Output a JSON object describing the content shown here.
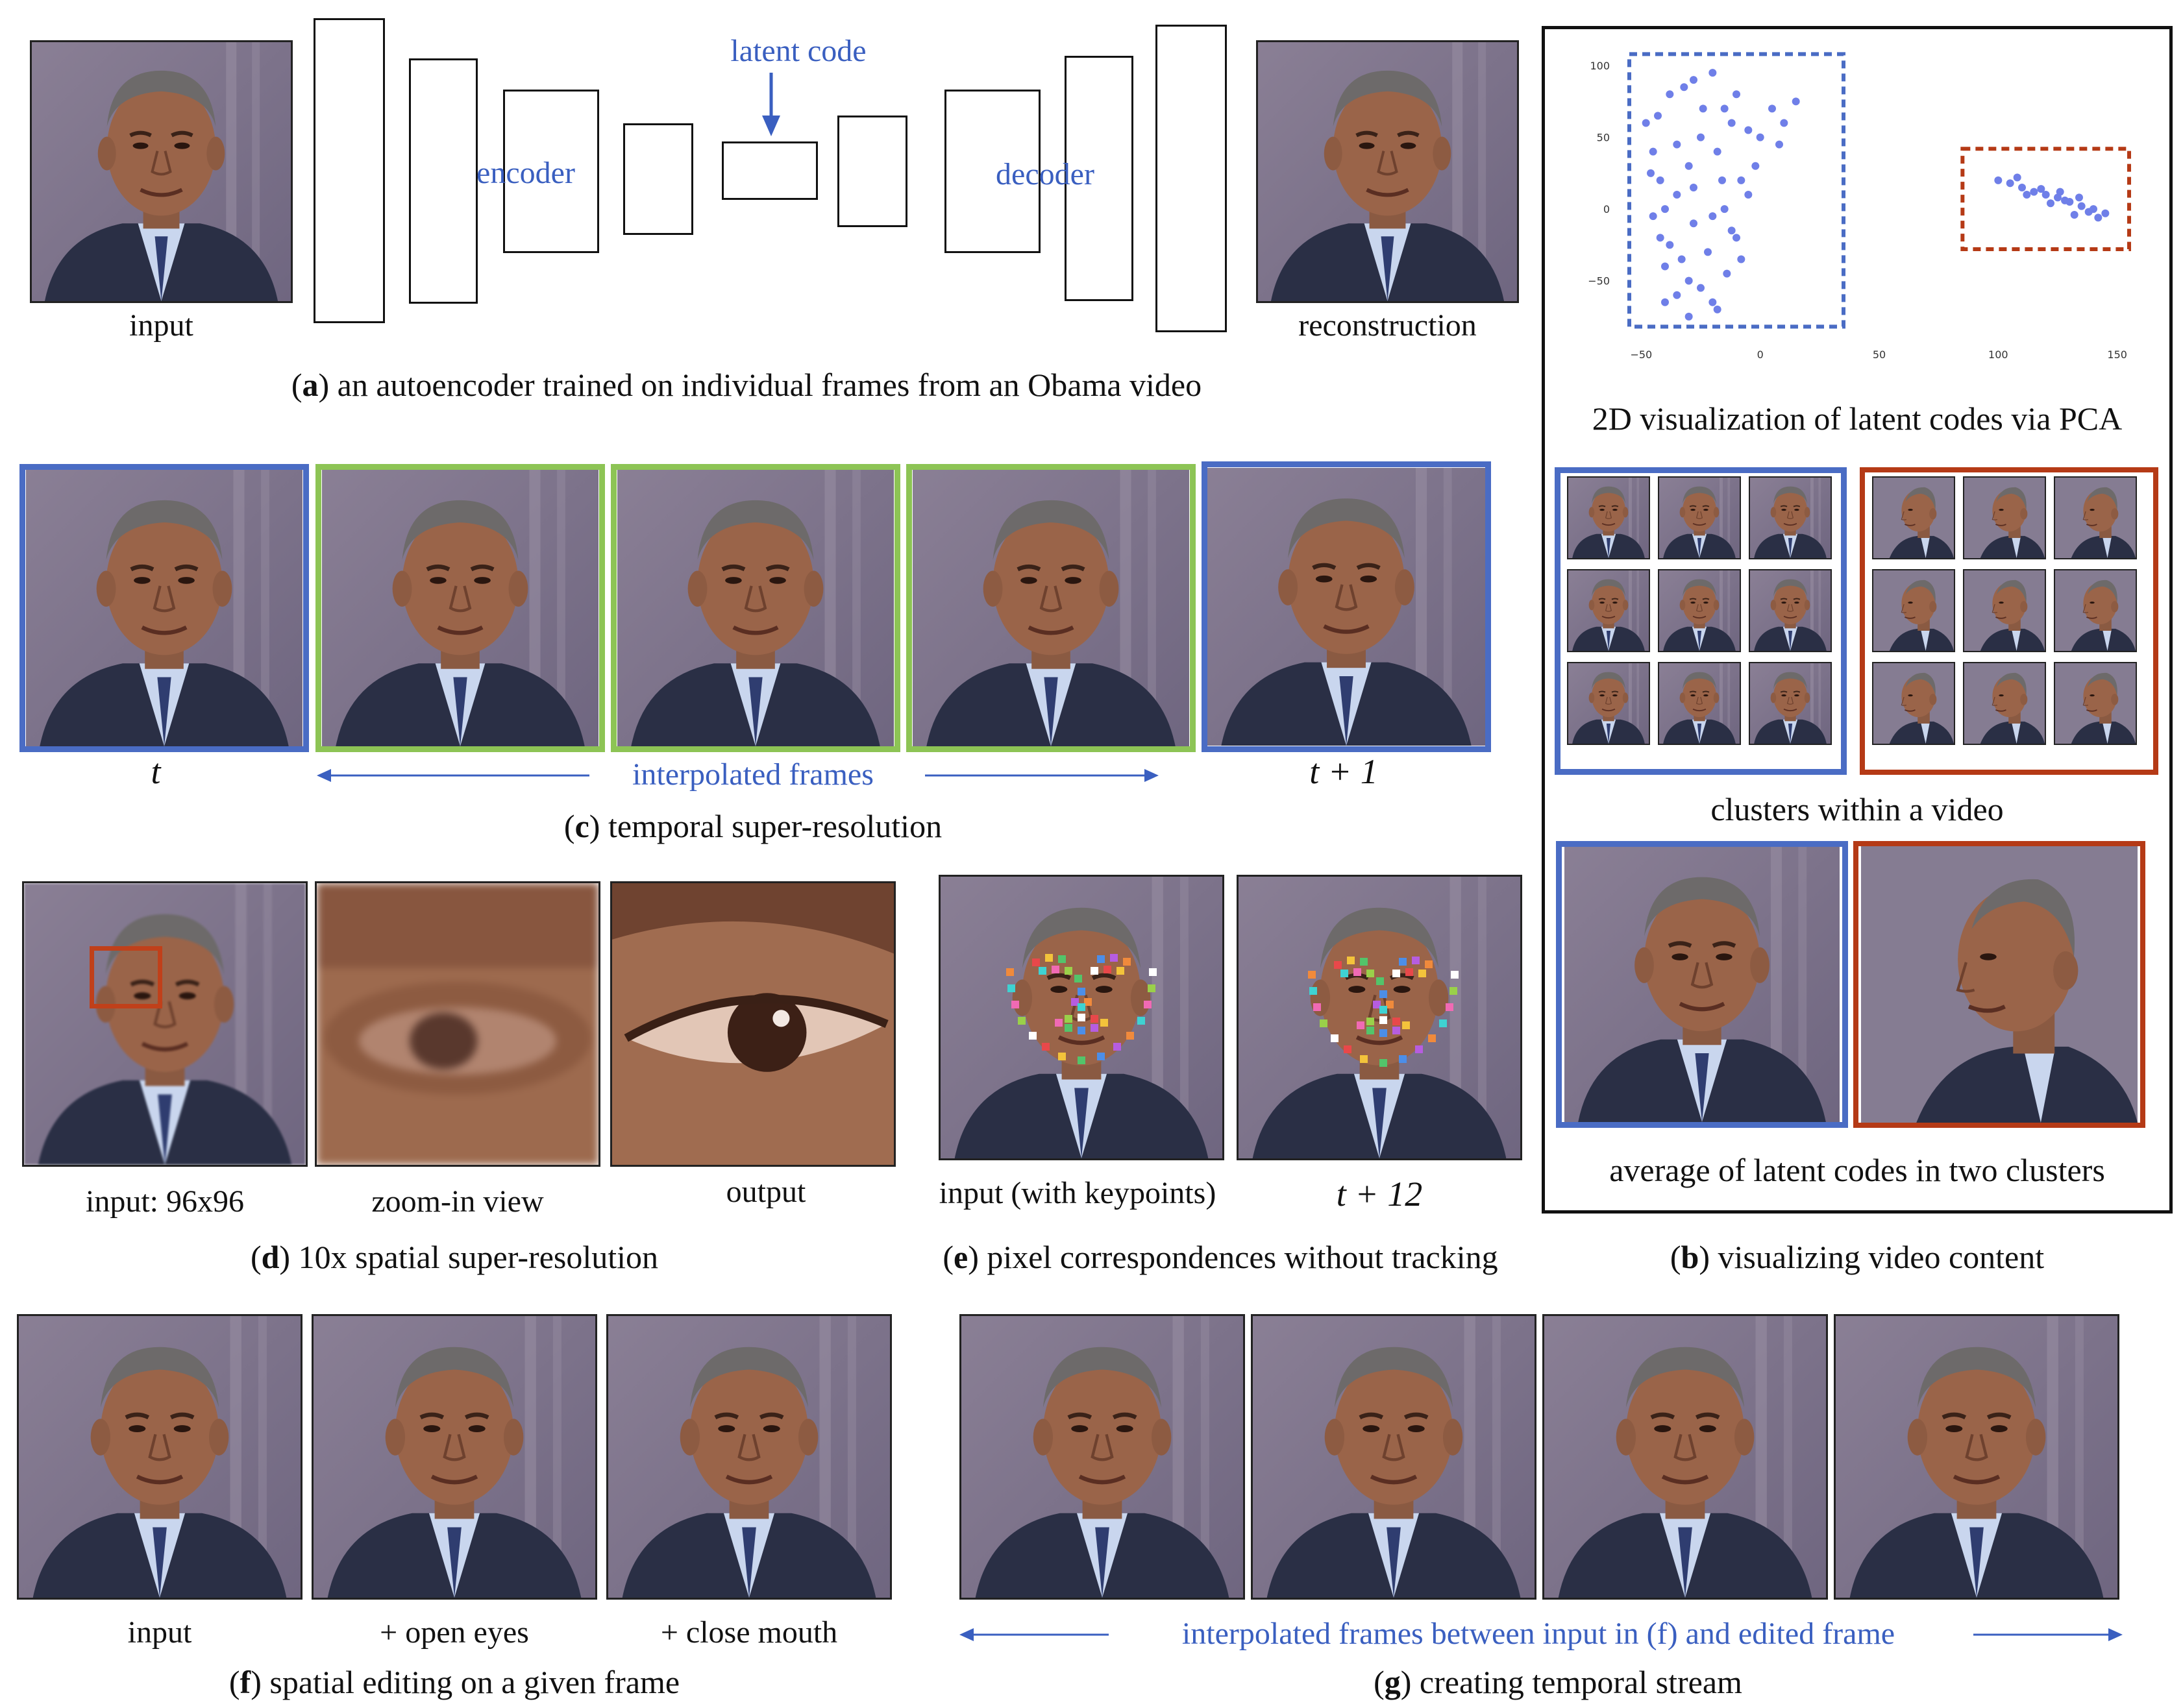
{
  "panel_a": {
    "input_label": "input",
    "reconstruction_label": "reconstruction",
    "encoder_label": "encoder",
    "decoder_label": "decoder",
    "latent_label": "latent code",
    "caption_letter": "a",
    "caption_text": " an autoencoder trained on individual frames from an Obama video"
  },
  "panel_b": {
    "pca_title": "2D visualization of latent codes via PCA",
    "clusters_label": "clusters within a video",
    "average_label": "average of latent codes in two clusters",
    "caption_letter": "b",
    "caption_text": " visualizing video content",
    "colors": {
      "cluster_a": "#4a6cc4",
      "cluster_b": "#b53a16",
      "points": "#6f7fe8"
    }
  },
  "chart_data": {
    "type": "scatter",
    "title": "",
    "xlabel": "",
    "ylabel": "",
    "xticks": [
      "−50",
      "0",
      "50",
      "100",
      "150"
    ],
    "yticks": [
      "100",
      "50",
      "0",
      "−50"
    ],
    "xlim": [
      -55,
      155
    ],
    "ylim": [
      -85,
      105
    ],
    "grid": false,
    "series": [
      {
        "points": [
          [
            -48,
            60
          ],
          [
            -45,
            40
          ],
          [
            -42,
            20
          ],
          [
            -40,
            0
          ],
          [
            -42,
            -20
          ],
          [
            -40,
            -40
          ],
          [
            -35,
            -60
          ],
          [
            -30,
            -75
          ],
          [
            -38,
            80
          ],
          [
            -32,
            85
          ],
          [
            -28,
            90
          ],
          [
            -20,
            95
          ],
          [
            -15,
            70
          ],
          [
            -25,
            50
          ],
          [
            -30,
            30
          ],
          [
            -35,
            10
          ],
          [
            -28,
            -10
          ],
          [
            -22,
            -30
          ],
          [
            -30,
            -50
          ],
          [
            -20,
            -65
          ],
          [
            -10,
            80
          ],
          [
            -12,
            60
          ],
          [
            -18,
            40
          ],
          [
            -8,
            20
          ],
          [
            -15,
            0
          ],
          [
            -10,
            -20
          ],
          [
            -14,
            -45
          ],
          [
            -5,
            55
          ],
          [
            5,
            70
          ],
          [
            -2,
            30
          ],
          [
            10,
            60
          ],
          [
            -45,
            -5
          ],
          [
            -38,
            -25
          ],
          [
            -25,
            -55
          ],
          [
            -18,
            -70
          ],
          [
            -43,
            65
          ],
          [
            -35,
            45
          ],
          [
            -28,
            15
          ],
          [
            -20,
            -5
          ],
          [
            -12,
            -15
          ],
          [
            15,
            75
          ],
          [
            0,
            50
          ],
          [
            -5,
            10
          ],
          [
            -8,
            -35
          ],
          [
            -40,
            -65
          ],
          [
            -46,
            25
          ],
          [
            -33,
            -35
          ],
          [
            -24,
            70
          ],
          [
            -16,
            20
          ],
          [
            8,
            45
          ]
        ]
      },
      {
        "points": [
          [
            100,
            20
          ],
          [
            105,
            18
          ],
          [
            110,
            15
          ],
          [
            115,
            12
          ],
          [
            120,
            10
          ],
          [
            125,
            8
          ],
          [
            130,
            5
          ],
          [
            135,
            2
          ],
          [
            140,
            0
          ],
          [
            145,
            -3
          ],
          [
            108,
            22
          ],
          [
            118,
            14
          ],
          [
            128,
            6
          ],
          [
            138,
            -2
          ],
          [
            122,
            4
          ],
          [
            132,
            -4
          ],
          [
            112,
            10
          ],
          [
            142,
            -6
          ],
          [
            126,
            12
          ],
          [
            134,
            8
          ]
        ]
      }
    ]
  },
  "panel_c": {
    "t_label": "t",
    "t1_label": "t + 1",
    "interp_label": "interpolated frames",
    "caption_letter": "c",
    "caption_text": " temporal super-resolution"
  },
  "panel_d": {
    "input_label": "input: 96x96",
    "zoom_label": "zoom-in view",
    "output_label": "output",
    "caption_letter": "d",
    "caption_text": " 10x spatial super-resolution"
  },
  "panel_e": {
    "input_label": "input (with keypoints)",
    "t12_label": "t + 12",
    "caption_letter": "e",
    "caption_text": " pixel correspondences without tracking"
  },
  "panel_f": {
    "input_label": "input",
    "open_eyes_label": "+ open eyes",
    "close_mouth_label": "+ close mouth",
    "caption_letter": "f",
    "caption_text": " spatial editing on a given frame"
  },
  "panel_g": {
    "interp_label": "interpolated frames between input in (f) and edited frame",
    "caption_letter": "g",
    "caption_text": " creating temporal stream"
  }
}
